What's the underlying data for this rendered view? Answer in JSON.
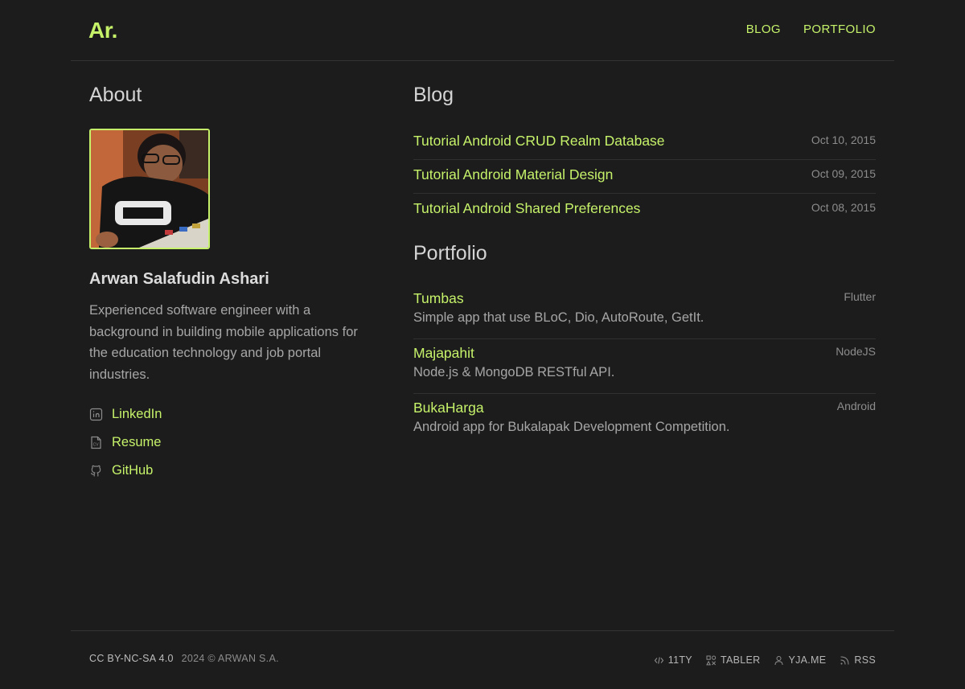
{
  "header": {
    "logo": "Ar.",
    "nav": [
      "BLOG",
      "PORTFOLIO"
    ]
  },
  "about": {
    "title": "About",
    "name": "Arwan Salafudin Ashari",
    "bio": "Experienced software engineer with a background in building mobile applications for the education technology and job portal industries.",
    "links": [
      {
        "label": "LinkedIn",
        "icon": "linkedin-icon"
      },
      {
        "label": "Resume",
        "icon": "cv-file-icon"
      },
      {
        "label": "GitHub",
        "icon": "github-icon"
      }
    ]
  },
  "blog": {
    "title": "Blog",
    "posts": [
      {
        "title": "Tutorial Android CRUD Realm Database",
        "date": "Oct 10, 2015"
      },
      {
        "title": "Tutorial Android Material Design",
        "date": "Oct 09, 2015"
      },
      {
        "title": "Tutorial Android Shared Preferences",
        "date": "Oct 08, 2015"
      }
    ]
  },
  "portfolio": {
    "title": "Portfolio",
    "items": [
      {
        "name": "Tumbas",
        "tag": "Flutter",
        "desc": "Simple app that use BLoC, Dio, AutoRoute, GetIt."
      },
      {
        "name": "Majapahit",
        "tag": "NodeJS",
        "desc": "Node.js & MongoDB RESTful API."
      },
      {
        "name": "BukaHarga",
        "tag": "Android",
        "desc": "Android app for Bukalapak Development Competition."
      }
    ]
  },
  "footer": {
    "license": "CC BY-NC-SA 4.0",
    "copyright": "2024 © ARWAN S.A.",
    "links": [
      {
        "label": "11TY",
        "icon": "code-icon"
      },
      {
        "label": "TABLER",
        "icon": "shapes-icon"
      },
      {
        "label": "YJA.ME",
        "icon": "user-icon"
      },
      {
        "label": "RSS",
        "icon": "rss-icon"
      }
    ]
  },
  "colors": {
    "background": "#1c1c1c",
    "accent": "#c6f26a",
    "text": "#bdbdbd",
    "muted": "#8c8c8c"
  }
}
